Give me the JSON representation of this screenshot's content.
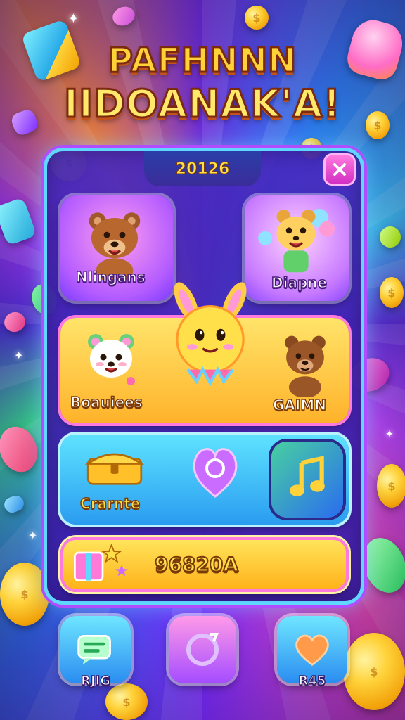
{
  "title": {
    "line1": "PAFHNNN",
    "line2": "IIDOANAK'A!"
  },
  "panel": {
    "year_label": "20126",
    "close_icon": "close-x-icon"
  },
  "cards": {
    "top_left": {
      "label": "Nlingans",
      "icon": "bear-character"
    },
    "top_right": {
      "label": "Diapne",
      "icon": "bear-with-balloons-character"
    },
    "middle_left": {
      "label": "Boauiees",
      "icon": "panda-character"
    },
    "middle_right": {
      "label": "GAIMN",
      "icon": "bear-character"
    },
    "center_mascot": "sun-bunny-mascot",
    "lower_left": {
      "label": "Crarnte",
      "icon": "treasure-chest-icon"
    },
    "lower_center": {
      "icon": "heart-bubble-icon"
    },
    "lower_right": {
      "icon": "music-note-icon"
    }
  },
  "score": {
    "value": "96820A",
    "icon": "gift-box-icon"
  },
  "bottom_nav": [
    {
      "label": "RJIG",
      "icon": "chat-bubble-icon"
    },
    {
      "label": "",
      "icon": "refresh-icon"
    },
    {
      "label": "R45",
      "icon": "heart-icon"
    }
  ],
  "colors": {
    "title_yellow": "#ffe14a",
    "panel_border": "#5fd7ff",
    "panel_glow": "#b24cff",
    "accent_pink": "#ff7adf",
    "accent_orange": "#ffb21a"
  }
}
